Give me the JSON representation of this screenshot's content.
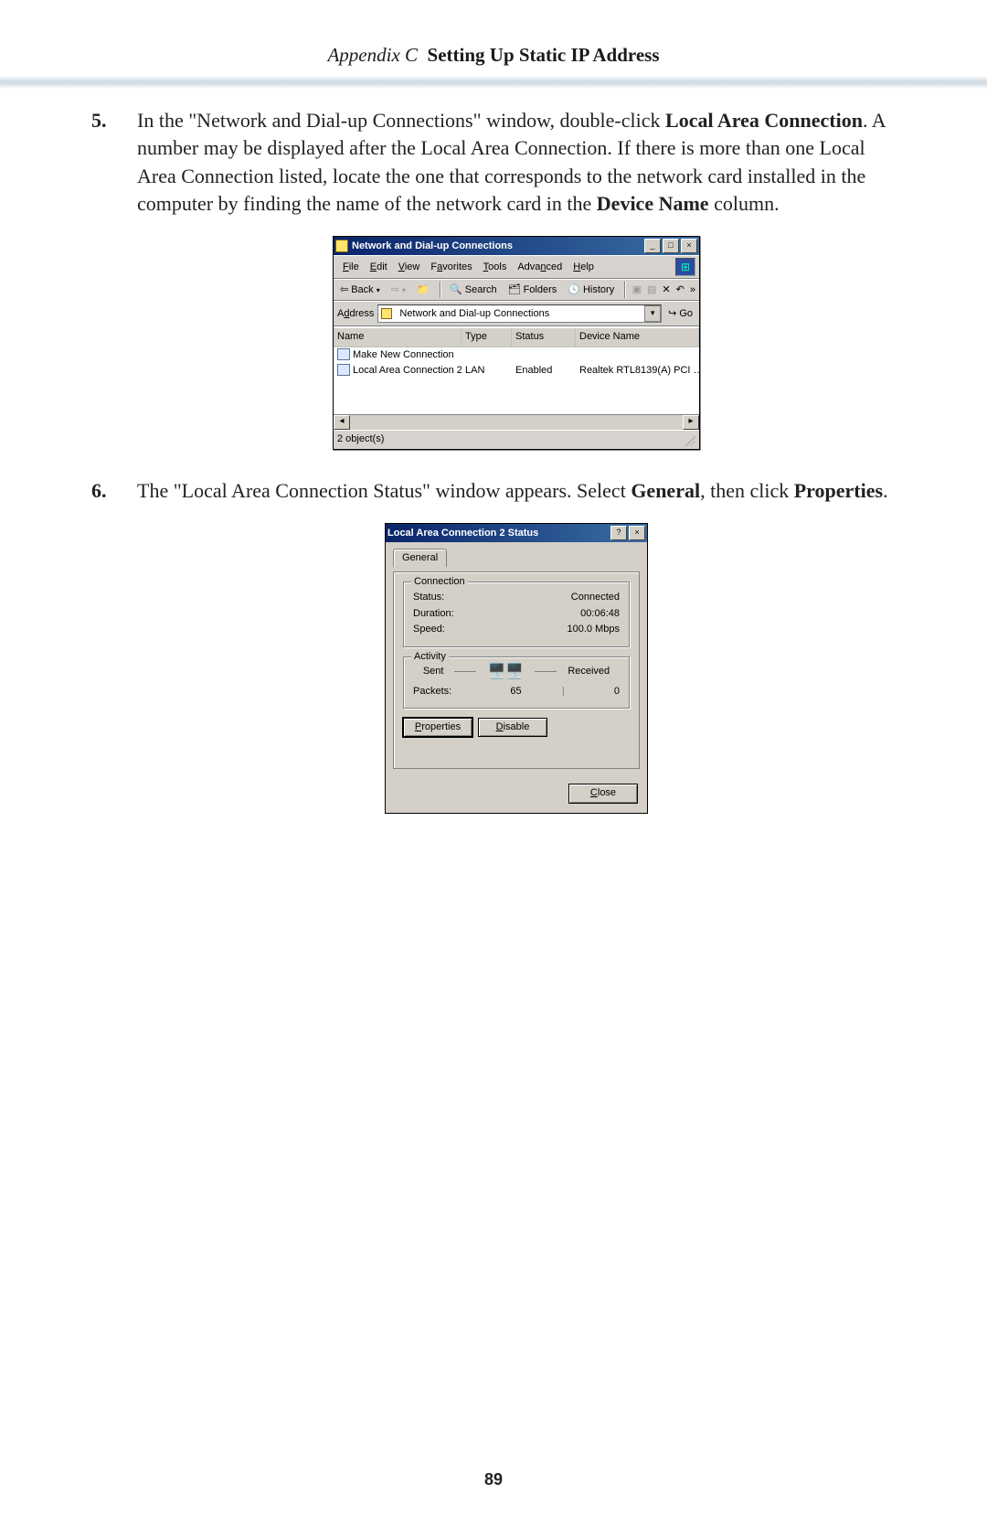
{
  "header": {
    "prefix": "Appendix C",
    "title": "Setting Up Static IP Address"
  },
  "page_number": "89",
  "steps": {
    "s5": {
      "number": "5.",
      "text_a": "In the \"Network and Dial-up Connections\" window, double-click ",
      "bold_a": "Local Area Connection",
      "text_b": ". A number may be displayed after the Local Area Connection. If there is more than one Local Area Connection listed, locate the one that corresponds to the network card installed in the computer by finding the name of the network card in the ",
      "bold_b": "Device Name",
      "text_c": " column."
    },
    "s6": {
      "number": "6.",
      "text_a": "The \"Local Area Connection Status\" window appears. Select ",
      "bold_a": "General",
      "text_b": ", then click ",
      "bold_b": "Properties",
      "text_c": "."
    }
  },
  "explorer": {
    "title": "Network and Dial-up Connections",
    "menu": {
      "file": "File",
      "edit": "Edit",
      "view": "View",
      "fav": "Favorites",
      "tools": "Tools",
      "adv": "Advanced",
      "help": "Help"
    },
    "toolbar": {
      "back": "Back",
      "search": "Search",
      "folders": "Folders",
      "history": "History",
      "more": "»"
    },
    "address": {
      "label": "Address",
      "value": "Network and Dial-up Connections",
      "go": "Go"
    },
    "columns": {
      "name": "Name",
      "type": "Type",
      "status": "Status",
      "device": "Device Name"
    },
    "rows": {
      "r0": {
        "name": "Make New Connection",
        "type": "",
        "status": "",
        "device": ""
      },
      "r1": {
        "name": "Local Area Connection 2",
        "type": "LAN",
        "status": "Enabled",
        "device": "Realtek RTL8139(A) PCI …"
      }
    },
    "status": "2 object(s)"
  },
  "status_dlg": {
    "title": "Local Area Connection 2 Status",
    "tab": "General",
    "conn": {
      "legend": "Connection",
      "status_lbl": "Status:",
      "status": "Connected",
      "duration_lbl": "Duration:",
      "duration": "00:06:48",
      "speed_lbl": "Speed:",
      "speed": "100.0 Mbps"
    },
    "activity": {
      "legend": "Activity",
      "sent_lbl": "Sent",
      "recv_lbl": "Received",
      "packets_lbl": "Packets:",
      "sent": "65",
      "recv": "0"
    },
    "buttons": {
      "properties": "Properties",
      "disable": "Disable",
      "close": "Close"
    }
  }
}
